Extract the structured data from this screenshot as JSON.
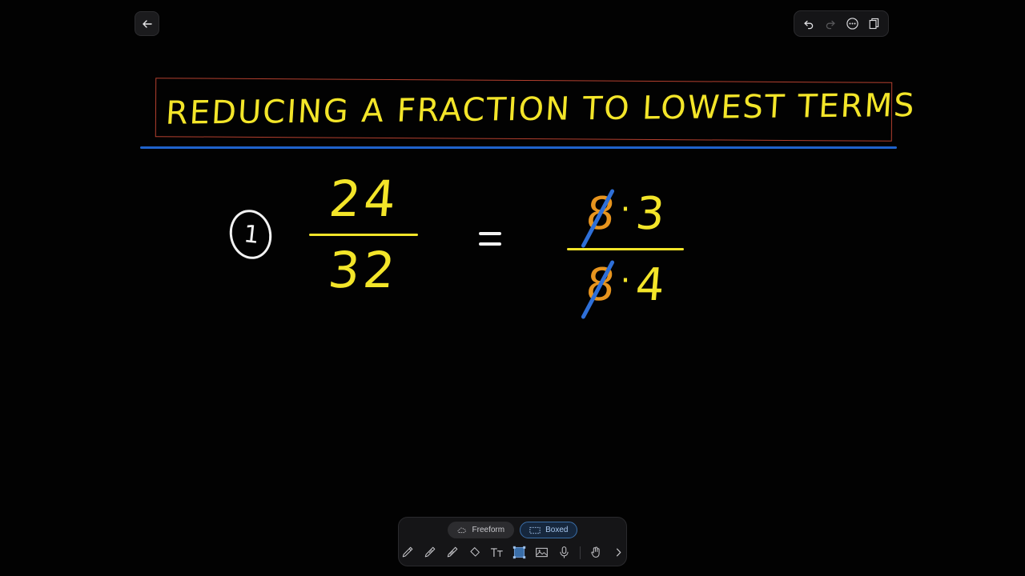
{
  "app": {
    "background_color": "#000000",
    "canvas_color": "#020202"
  },
  "header": {
    "back_label": "Back",
    "back_icon": "arrow-left-icon",
    "actions": [
      {
        "name": "undo",
        "label": "Undo",
        "icon": "undo-icon",
        "enabled": "true"
      },
      {
        "name": "redo",
        "label": "Redo",
        "icon": "redo-icon",
        "enabled": "false"
      },
      {
        "name": "more",
        "label": "More options",
        "icon": "ellipsis-circle-icon",
        "enabled": "true"
      },
      {
        "name": "pages",
        "label": "Pages",
        "icon": "copy-pages-icon",
        "enabled": "true"
      }
    ]
  },
  "whiteboard": {
    "title": "REDUCING A FRACTION  TO  LOWEST TERMS",
    "title_color": "#f3e529",
    "title_box_color": "#b4402f",
    "rule_color": "#1f63cc",
    "item_number": "1",
    "item_number_color": "#f2f2f2",
    "equation": {
      "equals": "=",
      "left": {
        "numerator": "24",
        "denominator": "32",
        "color": "#f3e529"
      },
      "right": {
        "numerator": {
          "cancelled_factor": "8",
          "operator": "·",
          "remaining_factor": "3"
        },
        "denominator": {
          "cancelled_factor": "8",
          "operator": "·",
          "remaining_factor": "4"
        },
        "cancelled_color": "#e8951e",
        "strike_color": "#2e6fd8",
        "color": "#f3e529"
      }
    }
  },
  "toolbar": {
    "modes": [
      {
        "label": "Freeform",
        "icon": "freeform-cloud-icon",
        "selected": "false"
      },
      {
        "label": "Boxed",
        "icon": "boxed-rect-icon",
        "selected": "true"
      }
    ],
    "tools": [
      {
        "name": "pen",
        "label": "Pen",
        "icon": "pen-icon",
        "selected": "false"
      },
      {
        "name": "pencil",
        "label": "Pencil",
        "icon": "pencil-icon",
        "selected": "false"
      },
      {
        "name": "highlighter",
        "label": "Highlighter",
        "icon": "highlighter-icon",
        "selected": "false"
      },
      {
        "name": "eraser",
        "label": "Eraser",
        "icon": "eraser-icon",
        "selected": "false"
      },
      {
        "name": "text",
        "label": "Text",
        "icon": "text-tt-icon",
        "selected": "false"
      },
      {
        "name": "select",
        "label": "Select",
        "icon": "selection-box-icon",
        "selected": "true"
      },
      {
        "name": "image",
        "label": "Insert image",
        "icon": "image-icon",
        "selected": "false"
      },
      {
        "name": "microphone",
        "label": "Record audio",
        "icon": "microphone-icon",
        "selected": "false"
      },
      {
        "name": "laser",
        "label": "Laser pointer",
        "icon": "hand-pointer-icon",
        "selected": "false"
      },
      {
        "name": "expand",
        "label": "More tools",
        "icon": "chevron-right-icon",
        "selected": "false"
      }
    ]
  }
}
